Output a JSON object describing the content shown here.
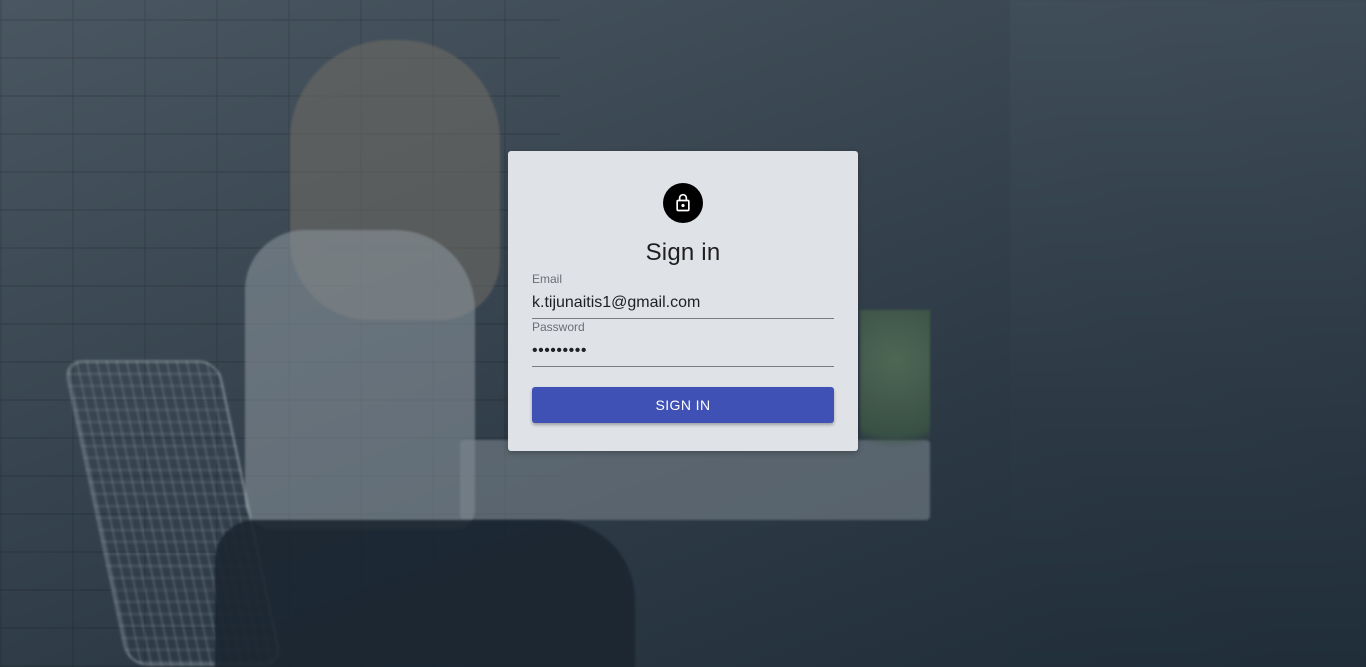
{
  "page": {
    "title": "Sign in"
  },
  "colors": {
    "card_background": "#dfe2e7",
    "avatar_background": "#000000",
    "button_background": "#3f51b5",
    "button_text": "#ffffff"
  },
  "icons": {
    "avatar": "lock-icon"
  },
  "form": {
    "email": {
      "label": "Email",
      "value": "k.tijunaitis1@gmail.com"
    },
    "password": {
      "label": "Password",
      "value": "•••••••••"
    },
    "submit_label": "SIGN IN"
  }
}
